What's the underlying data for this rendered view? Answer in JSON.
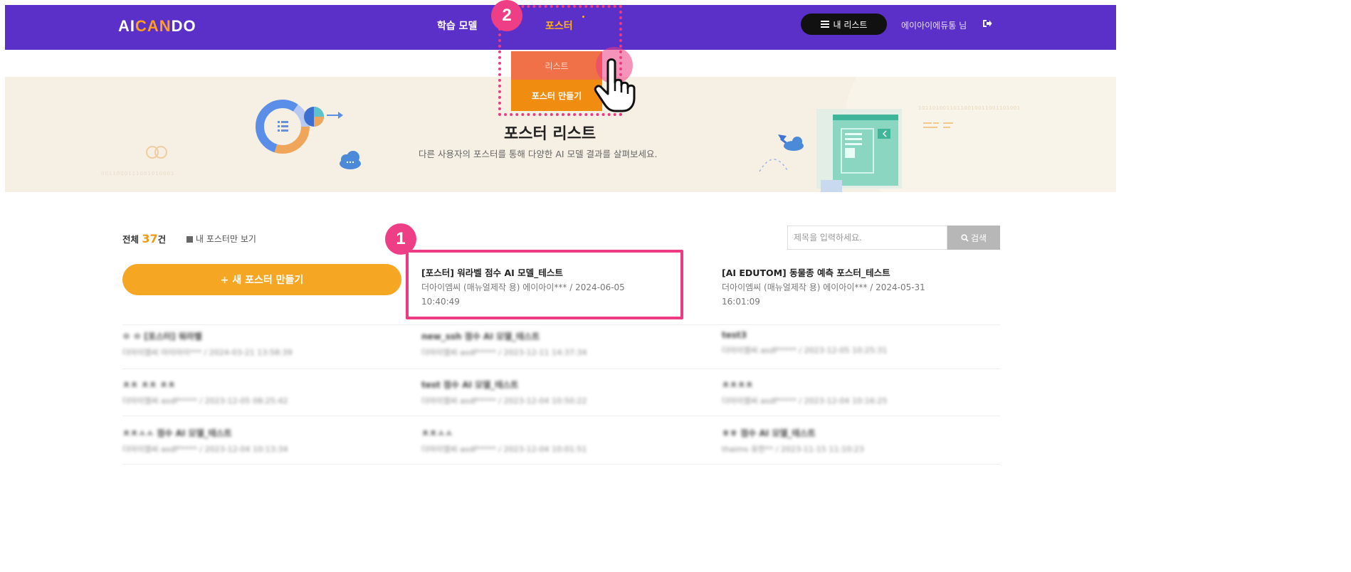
{
  "header": {
    "logo": {
      "a": "AI",
      "b": "CAN",
      "c": "DO"
    },
    "nav": {
      "learn": "학습 모델",
      "poster": "포스터"
    },
    "mylist": "내 리스트",
    "user": "에이아이에듀통 님"
  },
  "dropdown": {
    "list": "리스트",
    "make": "포스터 만들기"
  },
  "badges": {
    "one": "1",
    "two": "2"
  },
  "banner": {
    "title": "포스터 리스트",
    "subtitle": "다른 사용자의 포스터를 통해 다양한 AI 모델 결과를 살펴보세요.",
    "dots_left": "0011000111001010001",
    "dots_right": "10110100110110010011001101001"
  },
  "toolbar": {
    "total_prefix": "전체 ",
    "total_count": "37",
    "total_suffix": "건",
    "my_only": "내 포스터만 보기",
    "search_placeholder": "제목을 입력하세요.",
    "search_button": "검색",
    "new_poster": "+ 새 포스터 만들기"
  },
  "posters": [
    {
      "title": "[포스터] 워라벨 점수 AI 모델_테스트",
      "meta1": "더아이엠씨 (매뉴얼제작 용) 에이아이*** / 2024-06-05",
      "meta2": "10:40:49"
    },
    {
      "title": "[AI EDUTOM] 동물종 예측 포스터_테스트",
      "meta1": "더아이엠씨 (매뉴얼제작 용) 에이아이*** / 2024-05-31",
      "meta2": "16:01:09"
    }
  ],
  "blurred": [
    {
      "title": "ㅇ ㅇ [포스터] 워라벨",
      "meta": "더아이엠씨 아이아이*** / 2024-03-21 13:58:39"
    },
    {
      "title": "new_ssh 점수 AI 모델_테스트",
      "meta": "더아이엠씨 asdf***** / 2023-12-11 14:37:34"
    },
    {
      "title": "test3",
      "meta": "더아이엠씨 asdf***** / 2023-12-05 10:25:31"
    },
    {
      "title": "ㅊㅊ ㅊㅊ ㅊㅊ",
      "meta": "더아이엠씨 asdf***** / 2023-12-05 08:25:42"
    },
    {
      "title": "test 점수 AI 모델_테스트",
      "meta": "더아이엠씨 asdf***** / 2023-12-04 10:50:22"
    },
    {
      "title": "ㅊㅊㅊㅊ",
      "meta": "더아이엠씨 asdf***** / 2023-12-04 10:16:25"
    },
    {
      "title": "ㅊㅊㅅㅅ 점수 AI 모델_테스트",
      "meta": "더아이엠씨 asdf***** / 2023-12-04 10:13:34"
    },
    {
      "title": "ㅊㅊㅅㅅ",
      "meta": "더아이엠씨 asdf***** / 2023-12-04 10:01:51"
    },
    {
      "title": "ㅎㅎ 점수 AI 모델_테스트",
      "meta": "thaims 유한** / 2023-11-15 11:10:23"
    }
  ],
  "colors": {
    "header": "#5b30c8",
    "accent": "#f5a623",
    "highlight": "#ec3b82"
  }
}
